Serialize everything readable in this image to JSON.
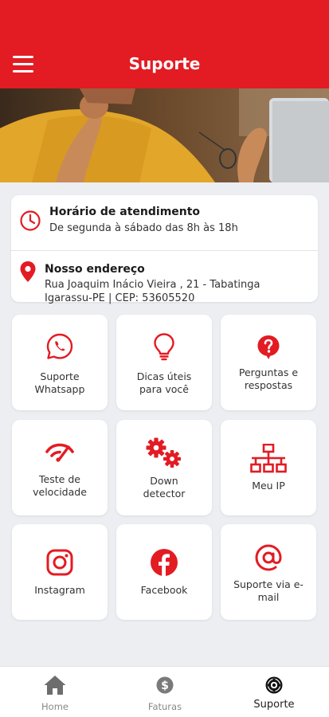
{
  "header": {
    "title": "Suporte",
    "menu_icon": "hamburger-menu-icon"
  },
  "hero": {
    "description": "photo"
  },
  "info": {
    "hours": {
      "title": "Horário de atendimento",
      "text": "De segunda à sábado das 8h às 18h",
      "icon": "clock-icon"
    },
    "address": {
      "title": "Nosso endereço",
      "line1": "Rua Joaquim Inácio Vieira , 21 - Tabatinga",
      "line2": "Igarassu-PE | CEP: 53605520",
      "icon": "location-pin-icon"
    }
  },
  "tiles": [
    {
      "line1": "Suporte",
      "line2": "Whatsapp",
      "icon": "whatsapp-icon"
    },
    {
      "line1": "Dicas úteis",
      "line2": "para você",
      "icon": "lightbulb-icon"
    },
    {
      "line1": "Perguntas e",
      "line2": "respostas",
      "icon": "question-icon"
    },
    {
      "line1": "Teste de",
      "line2": "velocidade",
      "icon": "speedometer-icon"
    },
    {
      "line1": "Down",
      "line2": "detector",
      "icon": "gears-icon"
    },
    {
      "line1": "Meu IP",
      "line2": "",
      "icon": "network-icon"
    },
    {
      "line1": "Instagram",
      "line2": "",
      "icon": "instagram-icon"
    },
    {
      "line1": "Facebook",
      "line2": "",
      "icon": "facebook-icon"
    },
    {
      "line1": "Suporte via e-",
      "line2": "mail",
      "icon": "at-sign-icon"
    }
  ],
  "bottom_nav": [
    {
      "label": "Home",
      "icon": "home-icon",
      "active": false
    },
    {
      "label": "Faturas",
      "icon": "dollar-icon",
      "active": false
    },
    {
      "label": "Suporte",
      "icon": "support-lifebuoy-icon",
      "active": true
    }
  ],
  "colors": {
    "accent": "#e31b23",
    "background": "#eceef2",
    "card": "#ffffff",
    "text": "#333333"
  }
}
